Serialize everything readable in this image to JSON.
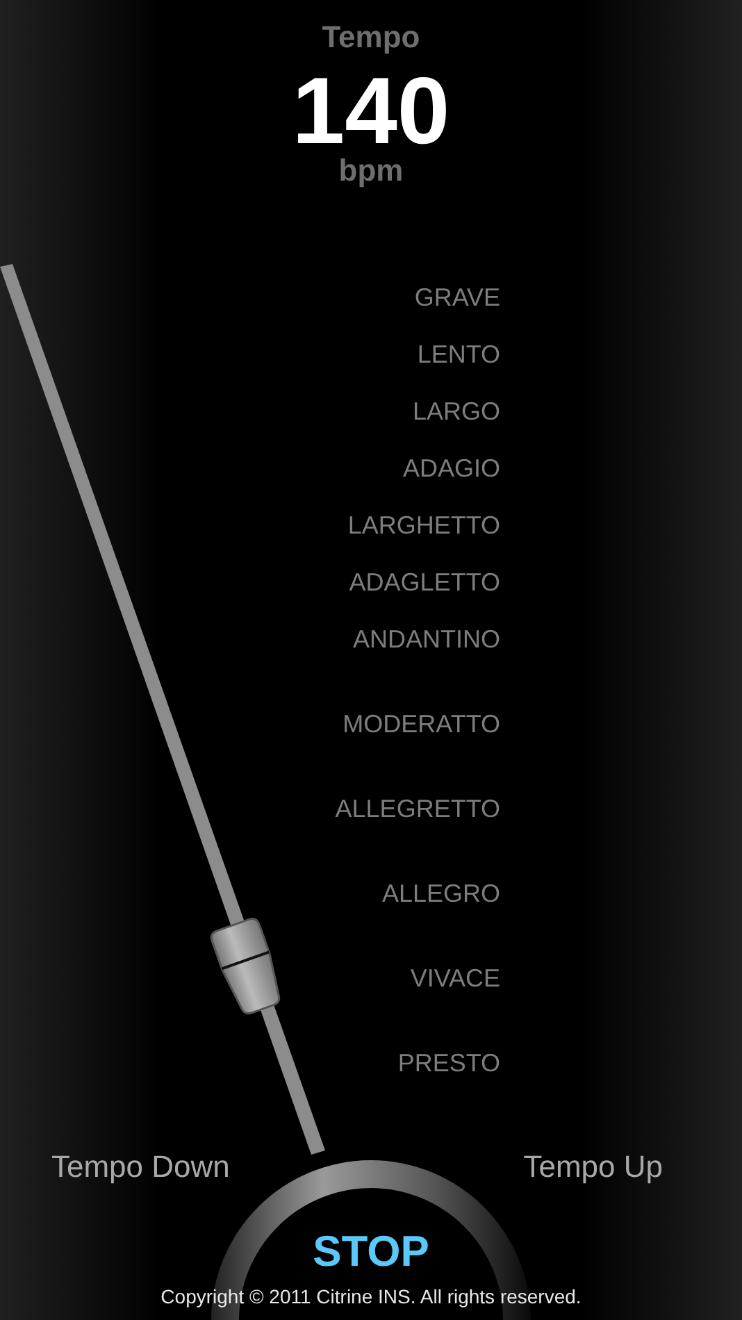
{
  "header": {
    "label": "Tempo",
    "value": "140",
    "unit": "bpm"
  },
  "tempo_names": [
    "GRAVE",
    "LENTO",
    "LARGO",
    "ADAGIO",
    "LARGHETTO",
    "ADAGLETTO",
    "ANDANTINO",
    "MODERATTO",
    "ALLEGRETTO",
    "ALLEGRO",
    "VIVACE",
    "PRESTO"
  ],
  "controls": {
    "tempo_down": "Tempo Down",
    "tempo_up": "Tempo Up",
    "start_stop": "STOP"
  },
  "footer": {
    "copyright": "Copyright © 2011 Citrine INS. All rights reserved."
  }
}
